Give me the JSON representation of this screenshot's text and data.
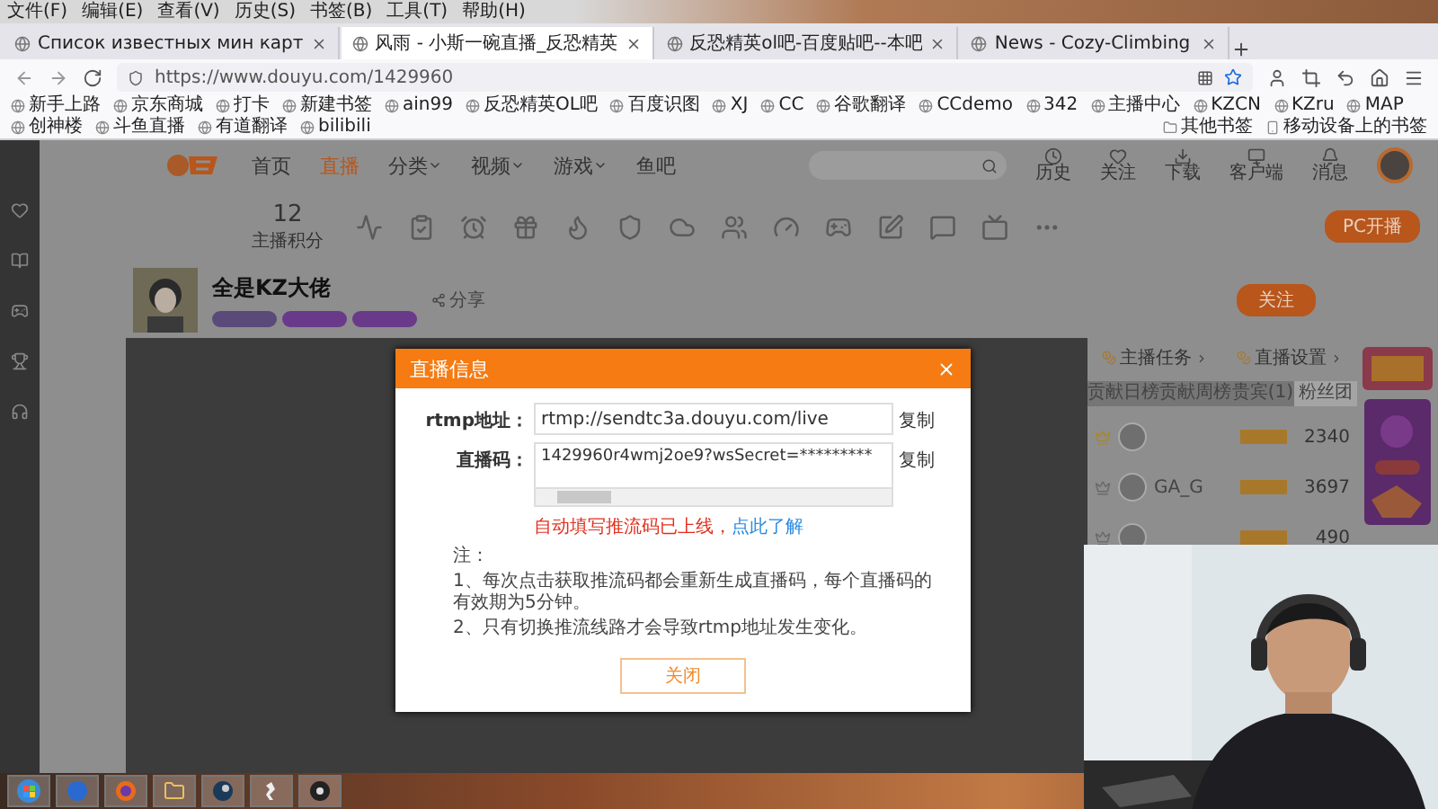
{
  "menu_bar": [
    "文件(F)",
    "编辑(E)",
    "查看(V)",
    "历史(S)",
    "书签(B)",
    "工具(T)",
    "帮助(H)"
  ],
  "tabs": [
    {
      "title": "Список известных мин карт",
      "selected": false
    },
    {
      "title": "风雨 - 小斯一碗直播_反恐精英",
      "selected": true
    },
    {
      "title": "反恐精英ol吧-百度贴吧--本吧",
      "selected": false
    },
    {
      "title": "News - Cozy-Climbing",
      "selected": false
    }
  ],
  "address_bar": {
    "url": "https://www.douyu.com/1429960"
  },
  "bookmarks": [
    "新手上路",
    "京东商城",
    "打卡",
    "新建书签",
    "ain99",
    "反恐精英OL吧",
    "百度识图",
    "XJ",
    "CC",
    "谷歌翻译",
    "CCdemo",
    "342",
    "主播中心",
    "KZCN",
    "KZru",
    "MAP",
    "创神楼",
    "斗鱼直播",
    "有道翻译",
    "bilibili"
  ],
  "other_bookmarks": [
    "其他书签",
    "移动设备上的书签"
  ],
  "site_nav": [
    {
      "label": "首页",
      "selected": false,
      "dropdown": false
    },
    {
      "label": "直播",
      "selected": true,
      "dropdown": false
    },
    {
      "label": "分类",
      "selected": false,
      "dropdown": true
    },
    {
      "label": "视频",
      "selected": false,
      "dropdown": true
    },
    {
      "label": "游戏",
      "selected": false,
      "dropdown": true
    },
    {
      "label": "鱼吧",
      "selected": false,
      "dropdown": false
    }
  ],
  "user_menu": [
    "历史",
    "关注",
    "下载",
    "客户端",
    "消息"
  ],
  "anchor_tools": {
    "points": "12",
    "points_label": "主播积分",
    "start_button": "PC开播"
  },
  "streamer": {
    "name": "全是KZ大佬",
    "follow_button": "关注",
    "share": "分享"
  },
  "ranking": {
    "links": [
      "主播任务",
      "直播设置"
    ],
    "tabs": [
      {
        "label": "贡献日榜",
        "selected": false
      },
      {
        "label": "贡献周榜",
        "selected": false
      },
      {
        "label": "贵宾(1)",
        "selected": false
      },
      {
        "label": "粉丝团",
        "selected": true
      }
    ],
    "rows": [
      {
        "score": "2340"
      },
      {
        "name": "GA_G",
        "score": "3697"
      },
      {
        "score": "490"
      }
    ]
  },
  "modal": {
    "title": "直播信息",
    "rtmp_label": "rtmp地址：",
    "rtmp_value": "rtmp://sendtc3a.douyu.com/live",
    "code_label": "直播码：",
    "code_value": "1429960r4wmj2oe9?wsSecret=*********",
    "copy": [
      "复制",
      "复制"
    ],
    "notice": "自动填写推流码已上线，",
    "notice_link": "点此了解",
    "notes_title": "注：",
    "notes": [
      "1、每次点击获取推流码都会重新生成直播码，每个直播码的有效期为5分钟。",
      "2、只有切换推流线路才会导致rtmp地址发生变化。"
    ],
    "close_button": "关闭"
  }
}
